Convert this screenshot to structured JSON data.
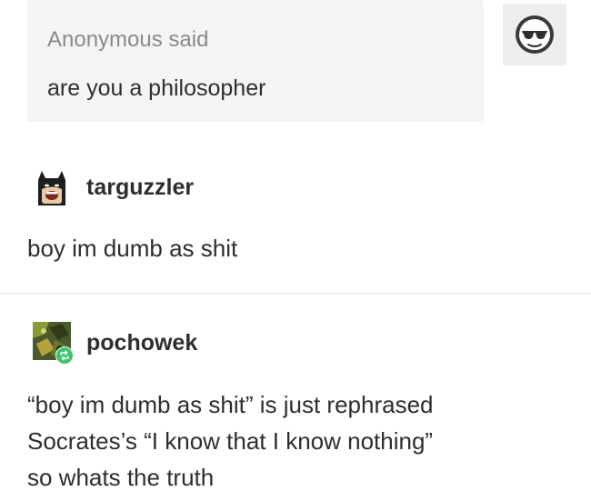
{
  "ask": {
    "asker_label": "Anonymous said",
    "question": "are you a philosopher",
    "avatar_icon": "sunglasses-face-icon"
  },
  "posts": [
    {
      "username": "targuzzler",
      "avatar_icon": "batman-lego-avatar",
      "lines": [
        "boy im dumb as shit"
      ]
    },
    {
      "username": "pochowek",
      "avatar_icon": "green-avatar-with-reblog-badge",
      "lines": [
        "“boy im dumb as shit” is just rephrased",
        "Socrates’s “I know that I know nothing”",
        "so whats the truth"
      ]
    }
  ],
  "colors": {
    "ask_background": "#f4f4f4",
    "reblog_badge": "#3cc46c",
    "divider": "#e2e2e2"
  }
}
